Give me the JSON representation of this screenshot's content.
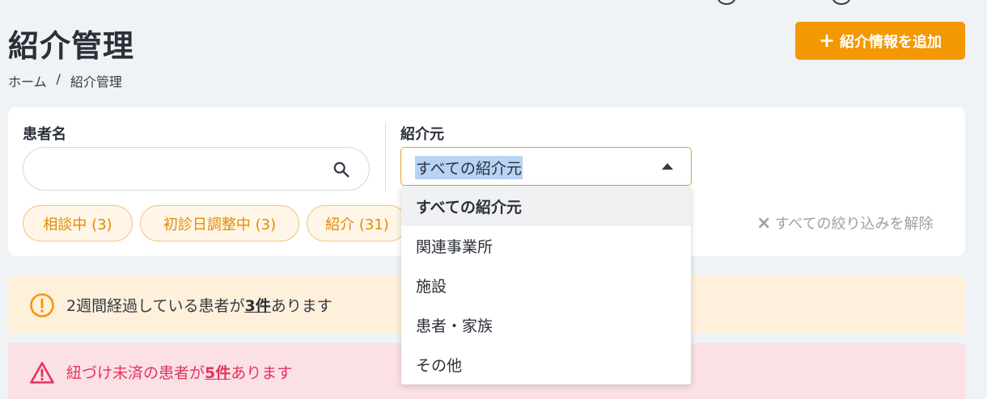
{
  "header": {
    "title": "紹介管理",
    "add_button_label": "紹介情報を追加",
    "breadcrumb": [
      "ホーム",
      "/",
      "紹介管理"
    ]
  },
  "filters": {
    "patient_name_label": "患者名",
    "patient_name_value": "",
    "referrer_label": "紹介元",
    "referrer_selected": "すべての紹介元",
    "referrer_options": [
      "すべての紹介元",
      "関連事業所",
      "施設",
      "患者・家族",
      "その他"
    ],
    "chips": [
      "相談中 (3)",
      "初診日調整中 (3)",
      "紹介 (31)"
    ],
    "clear_all_label": "すべての絞り込みを解除"
  },
  "alerts": {
    "warning": {
      "prefix": "2週間経過している患者が",
      "count": "3件",
      "suffix": "あります"
    },
    "danger": {
      "prefix": "紐づけ未済の患者が",
      "count": "5件",
      "suffix": "あります"
    }
  },
  "colors": {
    "accent": "#f39800",
    "warning_bg": "#fff0dc",
    "danger_bg": "#fbe0e6",
    "danger_text": "#e5335c"
  }
}
